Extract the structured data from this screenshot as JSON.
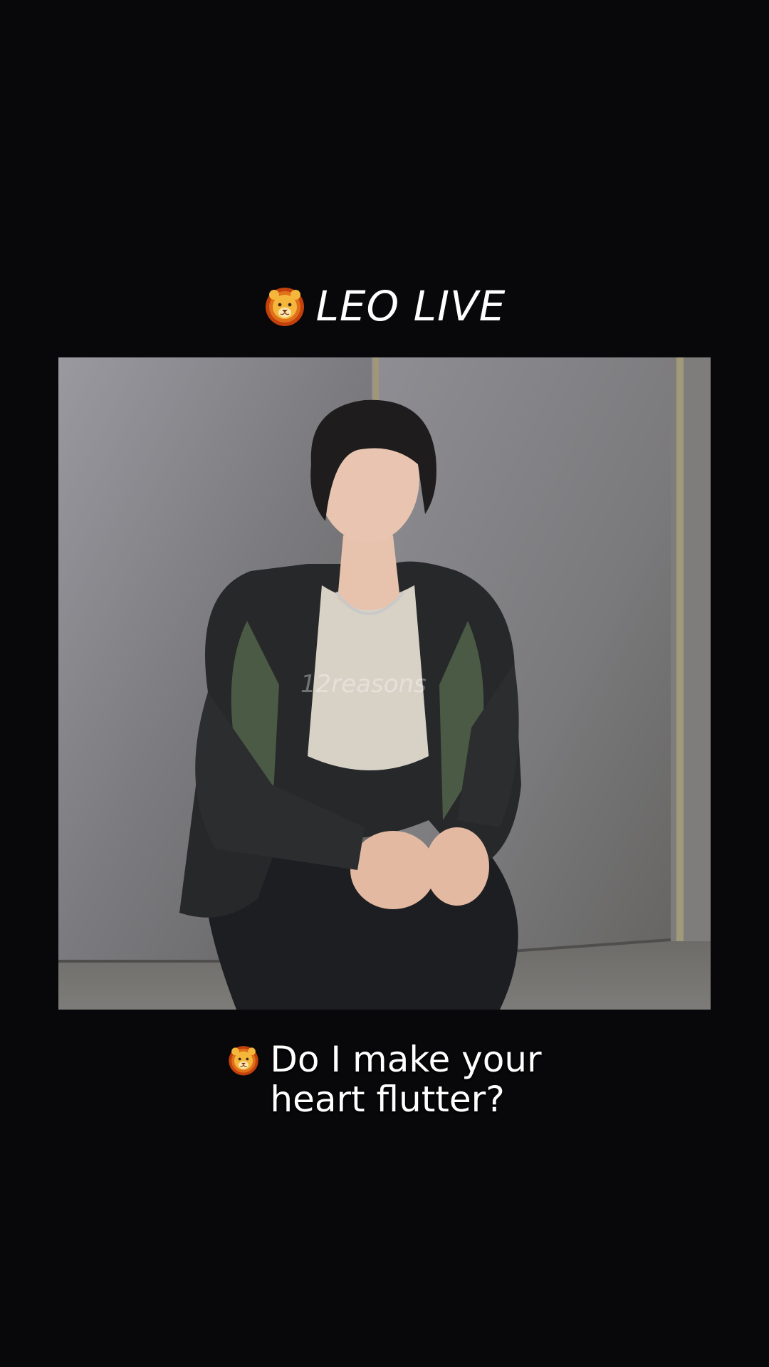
{
  "header": {
    "icon": "lion-face-icon",
    "title": "LEO LIVE"
  },
  "photo": {
    "watermark": "12reasons"
  },
  "caption": {
    "icon": "lion-face-icon",
    "lines": [
      "Do I make your",
      "heart flutter?"
    ]
  },
  "colors": {
    "background": "#08080a",
    "text": "#ffffff",
    "lion_mane": "#c2410c",
    "lion_face": "#f5b73b"
  }
}
